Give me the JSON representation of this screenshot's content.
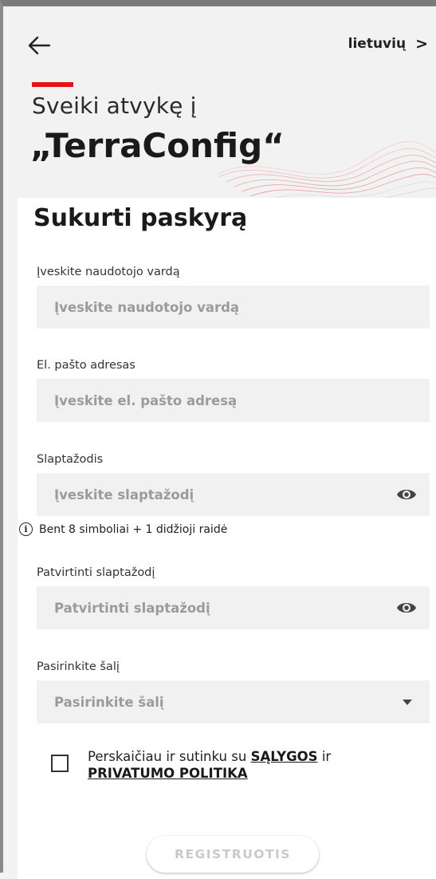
{
  "header": {
    "language_label": "lietuvių",
    "language_chevron": ">",
    "welcome_line": "Sveiki atvykę į",
    "brand_name": "„TerraConfig“"
  },
  "icons": {
    "back": "arrow-left-icon",
    "language": "chevron-right-icon",
    "password_visibility": "eye-icon",
    "select": "caret-down-icon",
    "info": "info-circle-icon"
  },
  "colors": {
    "accent": "#e3141a",
    "field_bg": "#f1f1f1",
    "placeholder": "#9b9b9b",
    "disabled_button_text": "#c9c9c9"
  },
  "form": {
    "title": "Sukurti paskyrą",
    "username": {
      "label": "Įveskite naudotojo vardą",
      "placeholder": "Įveskite naudotojo vardą"
    },
    "email": {
      "label": "El. pašto adresas",
      "placeholder": "Įveskite el. pašto adresą"
    },
    "password": {
      "label": "Slaptažodis",
      "placeholder": "Įveskite slaptažodį",
      "hint": "Bent 8 simboliai + 1 didžioji raidė",
      "info_glyph": "i"
    },
    "confirm_password": {
      "label": "Patvirtinti slaptažodį",
      "placeholder": "Patvirtinti slaptažodį"
    },
    "country": {
      "label": "Pasirinkite šalį",
      "placeholder": "Pasirinkite šalį"
    },
    "consent": {
      "checked": false,
      "text_prefix": "Perskaičiau ir sutinku su",
      "terms_link": "SĄLYGOS",
      "text_middle": "ir",
      "privacy_link": "PRIVATUMO POLITIKA"
    },
    "submit_label": "REGISTRUOTIS"
  }
}
